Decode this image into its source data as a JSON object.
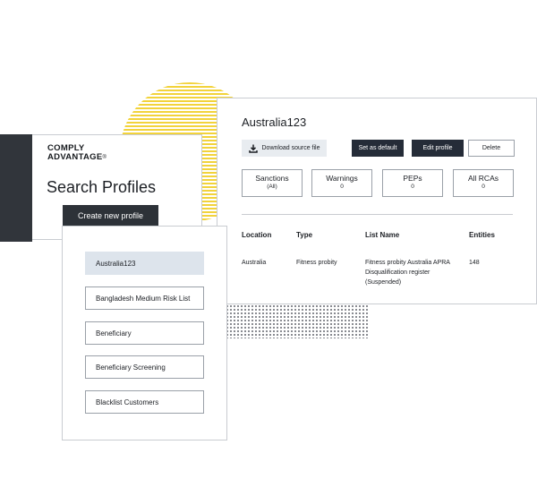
{
  "brand": {
    "logo_line1": "COMPLY",
    "logo_line2": "ADVANTAGE",
    "logo_mark": "®"
  },
  "search_profiles": {
    "title": "Search Profiles",
    "create_button": "Create new profile",
    "items": [
      {
        "label": "Australia123",
        "selected": true
      },
      {
        "label": "Bangladesh Medium Risk List",
        "selected": false
      },
      {
        "label": "Beneficiary",
        "selected": false
      },
      {
        "label": "Beneficiary Screening",
        "selected": false
      },
      {
        "label": "Blacklist Customers",
        "selected": false
      }
    ]
  },
  "profile_detail": {
    "title": "Australia123",
    "buttons": {
      "download": "Download source file",
      "set_default": "Set as default",
      "edit": "Edit profile",
      "delete": "Delete"
    },
    "download_icon": "download-icon",
    "stats": [
      {
        "label": "Sanctions",
        "value": "(All)"
      },
      {
        "label": "Warnings",
        "value": "0"
      },
      {
        "label": "PEPs",
        "value": "0"
      },
      {
        "label": "All RCAs",
        "value": "0"
      }
    ],
    "table": {
      "headers": [
        "Location",
        "Type",
        "List Name",
        "Entities"
      ],
      "rows": [
        {
          "location": "Australia",
          "type": "Fitness probity",
          "list_name": "Fitness probity Australia APRA Disqualification register (Suspended)",
          "entities": "148"
        }
      ]
    }
  },
  "colors": {
    "accent_yellow": "#f2d33b",
    "dark_button": "#252c38",
    "selected_item": "#dde4ec",
    "dark_block": "#31353b"
  }
}
